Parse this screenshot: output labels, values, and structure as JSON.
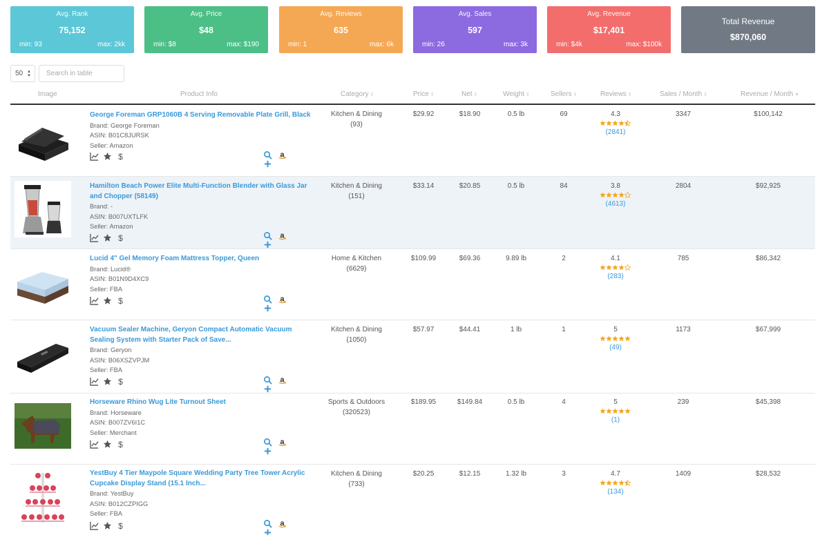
{
  "stats": [
    {
      "title": "Avg. Rank",
      "value": "75,152",
      "min": "min: 93",
      "max": "max: 2kk",
      "color": "#5cc7d6"
    },
    {
      "title": "Avg. Price",
      "value": "$48",
      "min": "min: $8",
      "max": "max: $190",
      "color": "#4cbf87"
    },
    {
      "title": "Avg. Reviews",
      "value": "635",
      "min": "min: 1",
      "max": "max: 6k",
      "color": "#f5a853"
    },
    {
      "title": "Avg. Sales",
      "value": "597",
      "min": "min: 26",
      "max": "max: 3k",
      "color": "#8c6ae0"
    },
    {
      "title": "Avg. Revenue",
      "value": "$17,401",
      "min": "min: $4k",
      "max": "max: $100k",
      "color": "#f36d6d"
    }
  ],
  "total": {
    "title": "Total Revenue",
    "value": "$870,060",
    "color": "#717a84"
  },
  "controls": {
    "page_size": "50",
    "search_placeholder": "Search in table"
  },
  "columns": [
    "Image",
    "Product Info",
    "Category",
    "Price",
    "Net",
    "Weight",
    "Sellers",
    "Reviews",
    "Sales / Month",
    "Revenue / Month"
  ],
  "products": [
    {
      "title": "George Foreman GRP1060B 4 Serving Removable Plate Grill, Black",
      "brand": "Brand: George Foreman",
      "asin": "ASIN: B01C8JURSK",
      "seller": "Seller: Amazon",
      "category": "Kitchen & Dining",
      "category_count": "(93)",
      "price": "$29.92",
      "net": "$18.90",
      "weight": "0.5 lb",
      "sellers": "69",
      "rating": "4.3",
      "reviews": "(2841)",
      "sales": "3347",
      "revenue": "$100,142",
      "image": "grill-image"
    },
    {
      "title": "Hamilton Beach Power Elite Multi-Function Blender with Glass Jar and Chopper (58149)",
      "brand": "Brand: -",
      "asin": "ASIN: B007UXTLFK",
      "seller": "Seller: Amazon",
      "category": "Kitchen & Dining",
      "category_count": "(151)",
      "price": "$33.14",
      "net": "$20.85",
      "weight": "0.5 lb",
      "sellers": "84",
      "rating": "3.8",
      "reviews": "(4613)",
      "sales": "2804",
      "revenue": "$92,925",
      "image": "blender-image"
    },
    {
      "title": "Lucid 4\" Gel Memory Foam Mattress Topper, Queen",
      "brand": "Brand: Lucid®",
      "asin": "ASIN: B01N9D4XC9",
      "seller": "Seller: FBA",
      "category": "Home & Kitchen",
      "category_count": "(6629)",
      "price": "$109.99",
      "net": "$69.36",
      "weight": "9.89 lb",
      "sellers": "2",
      "rating": "4.1",
      "reviews": "(283)",
      "sales": "785",
      "revenue": "$86,342",
      "image": "mattress-image"
    },
    {
      "title": "Vacuum Sealer Machine, Geryon Compact Automatic Vacuum Sealing System with Starter Pack of Save...",
      "brand": "Brand: Geryon",
      "asin": "ASIN: B06XSZVPJM",
      "seller": "Seller: FBA",
      "category": "Kitchen & Dining",
      "category_count": "(1050)",
      "price": "$57.97",
      "net": "$44.41",
      "weight": "1 lb",
      "sellers": "1",
      "rating": "5",
      "reviews": "(49)",
      "sales": "1173",
      "revenue": "$67,999",
      "image": "vacuum-sealer-image"
    },
    {
      "title": "Horseware Rhino Wug Lite Turnout Sheet",
      "brand": "Brand: Horseware",
      "asin": "ASIN: B007ZV6I1C",
      "seller": "Seller: Merchant",
      "category": "Sports & Outdoors",
      "category_count": "(320523)",
      "price": "$189.95",
      "net": "$149.84",
      "weight": "0.5 lb",
      "sellers": "4",
      "rating": "5",
      "reviews": "(1)",
      "sales": "239",
      "revenue": "$45,398",
      "image": "horse-sheet-image"
    },
    {
      "title": "YestBuy 4 Tier Maypole Square Wedding Party Tree Tower Acrylic Cupcake Display Stand (15.1 Inch...",
      "brand": "Brand: YestBuy",
      "asin": "ASIN: B012CZPIGG",
      "seller": "Seller: FBA",
      "category": "Kitchen & Dining",
      "category_count": "(733)",
      "price": "$20.25",
      "net": "$12.15",
      "weight": "1.32 lb",
      "sellers": "3",
      "rating": "4.7",
      "reviews": "(134)",
      "sales": "1409",
      "revenue": "$28,532",
      "image": "cupcake-stand-image"
    }
  ]
}
